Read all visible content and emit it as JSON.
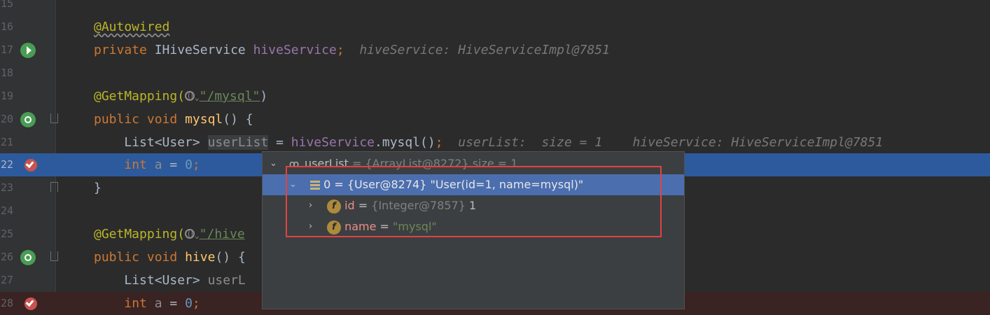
{
  "editor": {
    "lines": [
      {
        "num": "15"
      },
      {
        "num": "16",
        "annotation": "@Autowired"
      },
      {
        "num": "17",
        "kw": "private",
        "type": "IHiveService",
        "field": "hiveService",
        "semi": ";",
        "hint": "hiveService: HiveServiceImpl@7851"
      },
      {
        "num": "18"
      },
      {
        "num": "19",
        "ann": "@GetMapping(",
        "str": "\"/mysql\"",
        "close": ")"
      },
      {
        "num": "20",
        "kw1": "public",
        "kw2": "void",
        "fn": "mysql",
        "rest": "() {"
      },
      {
        "num": "21",
        "type": "List<User>",
        "var": "userList",
        "eq": " = ",
        "field": "hiveService",
        "call": ".mysql()",
        "semi": ";",
        "hint1": "userList:  size = 1",
        "hint2": "hiveService: HiveServiceImpl@7851"
      },
      {
        "num": "22",
        "kw": "int",
        "var": "a",
        "eq": " = ",
        "num_val": "0",
        "semi": ";"
      },
      {
        "num": "23",
        "text": "}"
      },
      {
        "num": "24"
      },
      {
        "num": "25",
        "ann": "@GetMapping(",
        "str": "\"/hive"
      },
      {
        "num": "26",
        "kw1": "public",
        "kw2": "void",
        "fn": "hive",
        "rest": "() {"
      },
      {
        "num": "27",
        "type": "List<User>",
        "var": "userL"
      },
      {
        "num": "28",
        "kw": "int",
        "var": "a",
        "eq": " = ",
        "num_val": "0",
        "semi": ";"
      }
    ]
  },
  "popup": {
    "root": {
      "name": "userList",
      "value": "= {ArrayList@8272}  size = 1"
    },
    "item0": {
      "text": "0 = {User@8274} \"User(id=1, name=mysql)\""
    },
    "id": {
      "name": "id",
      "eq": " = ",
      "ref": "{Integer@7857}",
      "value": "1"
    },
    "nm": {
      "name": "name",
      "eq": " = ",
      "value": "\"mysql\""
    }
  },
  "colors": {
    "highlight": "#2d5a9c",
    "selection": "#4b6eaf",
    "redbox": "#e04343"
  }
}
